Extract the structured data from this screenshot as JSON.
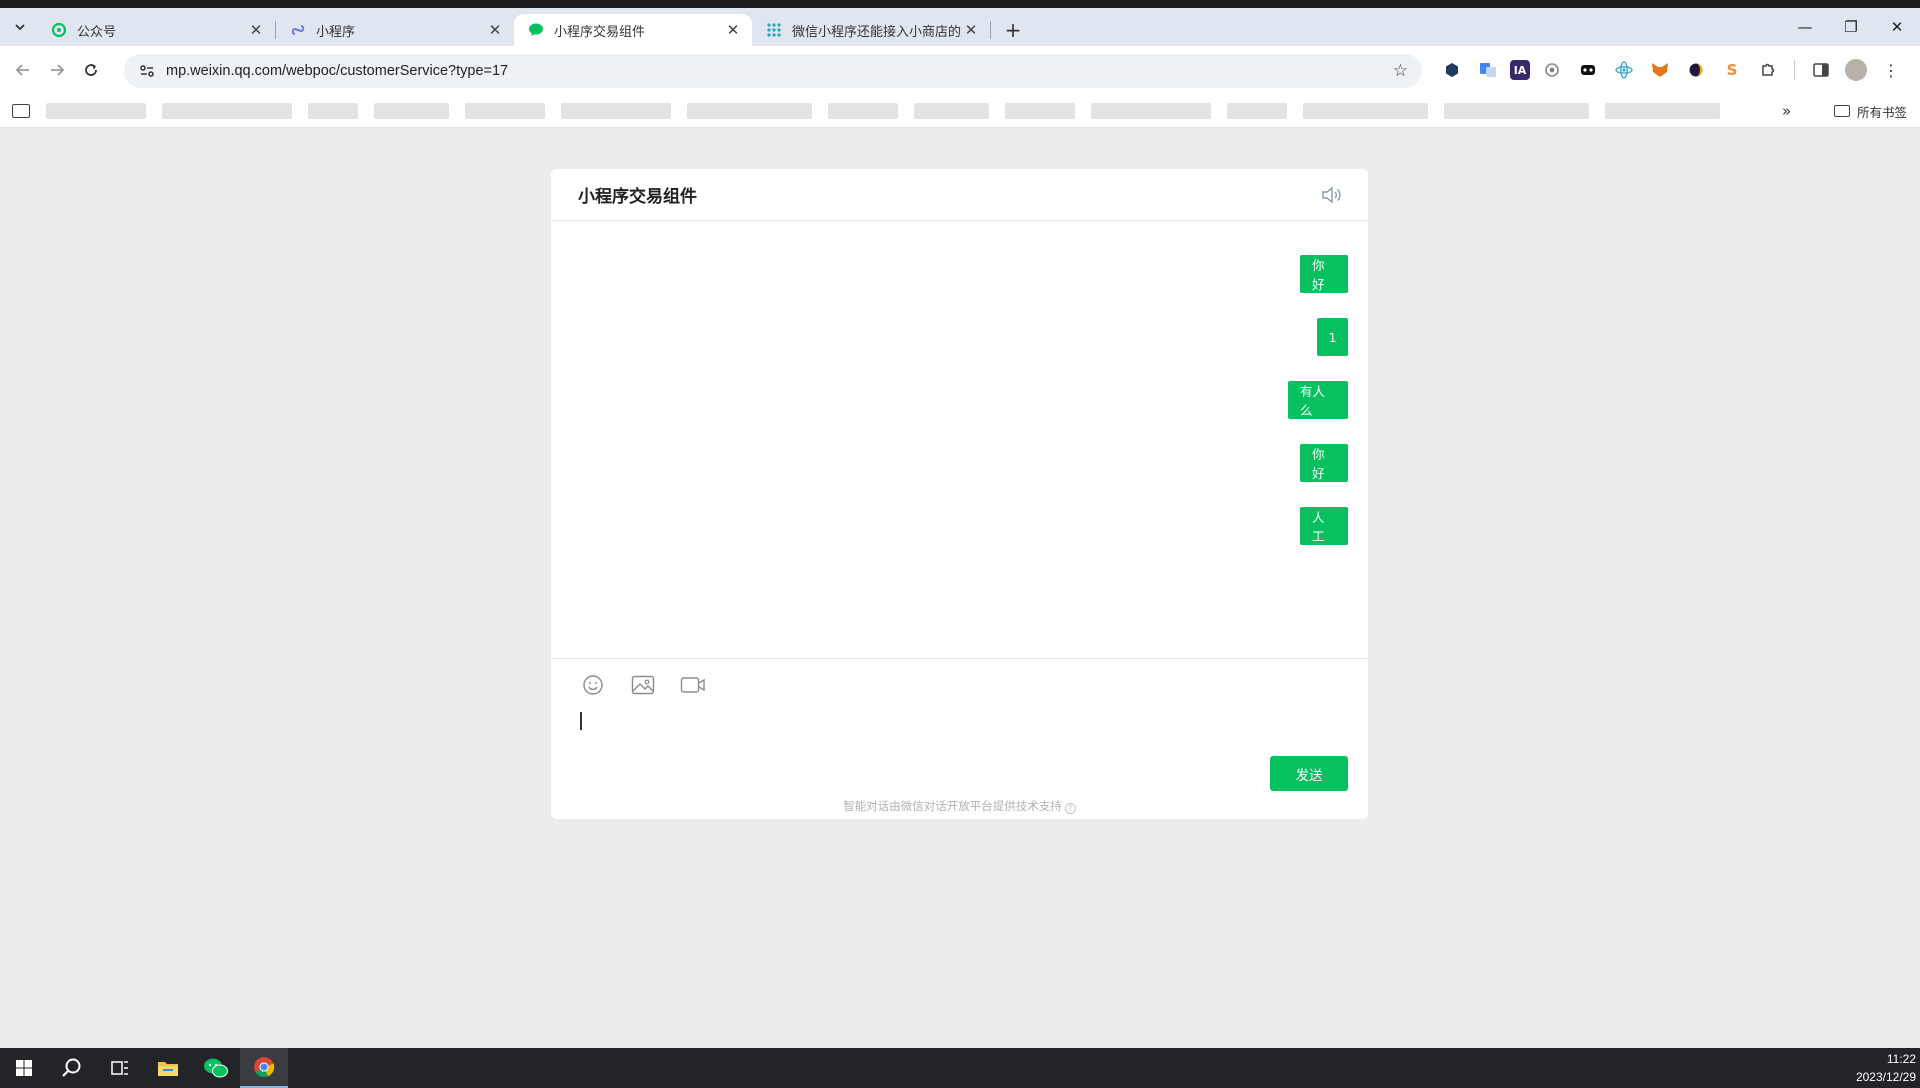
{
  "browser": {
    "tabs": [
      {
        "title": "公众号",
        "active": false
      },
      {
        "title": "小程序",
        "active": false
      },
      {
        "title": "小程序交易组件",
        "active": true
      },
      {
        "title": "微信小程序还能接入小商店的交",
        "active": false
      }
    ],
    "new_tab_label": "+",
    "url": "mp.weixin.qq.com/webpoc/customerService?type=17",
    "bookmarks_all_label": "所有书签",
    "bookmarks_more": "»",
    "extensions_colors": [
      "#1e3a5f",
      "#4285f4",
      "#6a1b9a",
      "#888888",
      "#111111",
      "#3aa3c4",
      "#e2761b",
      "#333333",
      "#f08c3a",
      "#444444"
    ]
  },
  "chat": {
    "title": "小程序交易组件",
    "messages": [
      {
        "text": "你好",
        "from": "user"
      },
      {
        "text": "1",
        "from": "user"
      },
      {
        "text": "有人么",
        "from": "user"
      },
      {
        "text": "你好",
        "from": "user"
      },
      {
        "text": "人工",
        "from": "user"
      }
    ],
    "send_label": "发送",
    "footer_note": "智能对话由微信对话开放平台提供技术支持",
    "accent_color": "#07c160"
  },
  "taskbar": {
    "time": "11:22",
    "date": "2023/12/29"
  }
}
